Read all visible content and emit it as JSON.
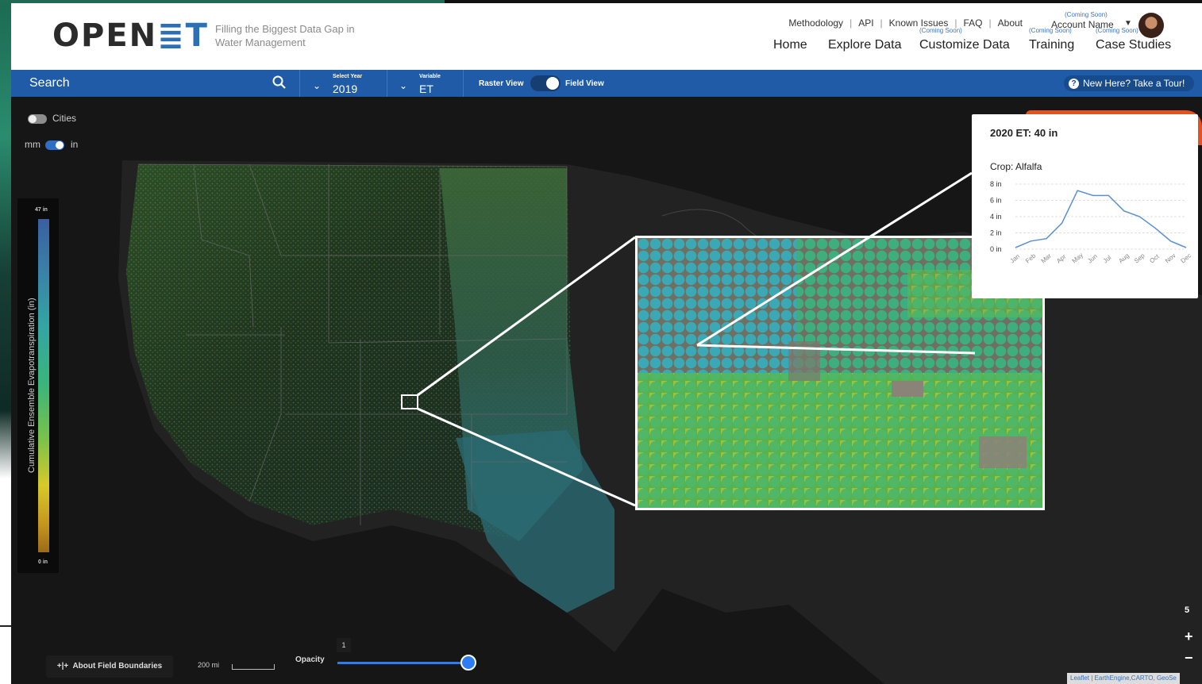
{
  "header": {
    "logo_text": "OPEN",
    "logo_accent": "≣T",
    "tagline": "Filling the Biggest Data Gap in Water Management",
    "top_links": [
      "Methodology",
      "API",
      "Known Issues",
      "FAQ",
      "About"
    ],
    "account": {
      "coming_soon": "(Coming Soon)",
      "name": "Account Name"
    },
    "main_nav": [
      {
        "label": "Home",
        "coming_soon": ""
      },
      {
        "label": "Explore Data",
        "coming_soon": ""
      },
      {
        "label": "Customize Data",
        "coming_soon": "(Coming Soon)"
      },
      {
        "label": "Training",
        "coming_soon": "(Coming Soon)"
      },
      {
        "label": "Case Studies",
        "coming_soon": "(Coming Soon)"
      }
    ]
  },
  "toolbar": {
    "search_label": "Search",
    "year_caption": "Select Year",
    "year_value": "2019",
    "variable_caption": "Variable",
    "variable_value": "ET",
    "raster_label": "Raster View",
    "field_label": "Field View",
    "tour_label": "New Here? Take a Tour!"
  },
  "map": {
    "cities_label": "Cities",
    "unit_left": "mm",
    "unit_right": "in",
    "legend": {
      "title": "Cumulative Ensemble Evapotranspiration (in)",
      "max": "47 in",
      "min": "0 in"
    },
    "about_fields": "About Field Boundaries",
    "scale_label": "200 mi",
    "opacity_label": "Opacity",
    "opacity_value": "1",
    "zoom_level": "5",
    "zoom_in": "+",
    "zoom_out": "−",
    "attribution": "Leaflet | EarthEngine,CARTO, GeoSe"
  },
  "popup": {
    "title": "2020 ET: 40 in",
    "crop": "Crop: Alfalfa"
  },
  "chart_data": {
    "type": "line",
    "categories": [
      "Jan",
      "Feb",
      "Mar",
      "Apr",
      "May",
      "Jun",
      "Jul",
      "Aug",
      "Sep",
      "Oct",
      "Nov",
      "Dec"
    ],
    "series": [
      {
        "values": [
          0.2,
          1.0,
          1.3,
          3.2,
          7.2,
          6.6,
          6.6,
          4.7,
          4.0,
          2.6,
          1.0,
          0.2
        ]
      }
    ],
    "yticks": [
      "0 in",
      "2 in",
      "4 in",
      "6 in",
      "8 in"
    ],
    "ylim": [
      0,
      8
    ],
    "line_color": "#5b8fd6"
  }
}
